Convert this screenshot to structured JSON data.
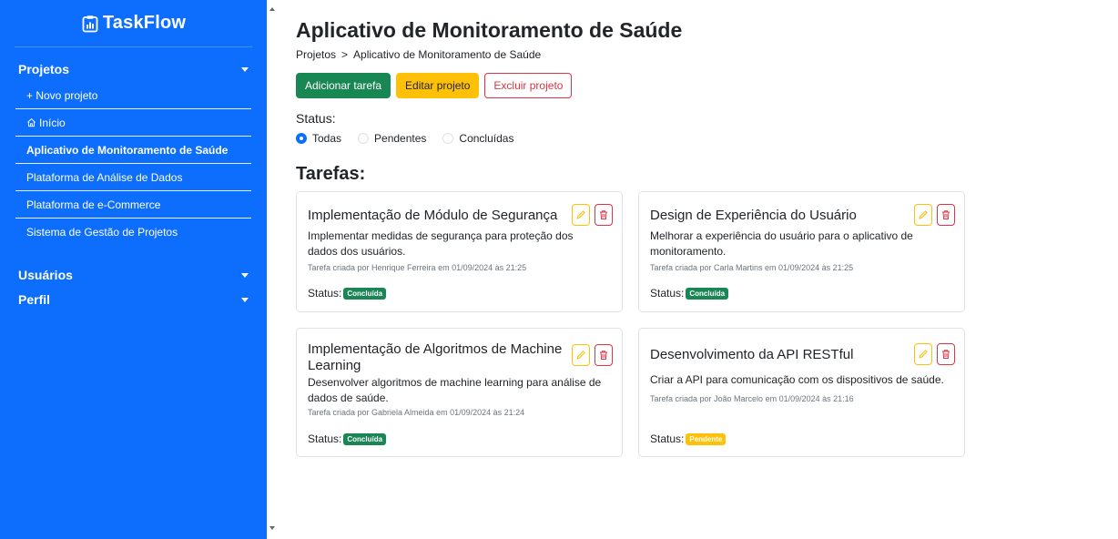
{
  "app": {
    "brand": "TaskFlow"
  },
  "sidebar": {
    "projects_heading": "Projetos",
    "items": [
      {
        "label": "+ Novo projeto"
      },
      {
        "label": "Início"
      },
      {
        "label": "Aplicativo de Monitoramento de Saúde"
      },
      {
        "label": "Plataforma de Análise de Dados"
      },
      {
        "label": "Plataforma de e-Commerce"
      },
      {
        "label": "Sistema de Gestão de Projetos"
      }
    ],
    "users_heading": "Usuários",
    "profile_heading": "Perfil"
  },
  "page": {
    "title": "Aplicativo de Monitoramento de Saúde",
    "breadcrumb": {
      "root": "Projetos",
      "separator": ">",
      "current": "Aplicativo de Monitoramento de Saúde"
    }
  },
  "actions": {
    "add": "Adicionar tarefa",
    "edit": "Editar projeto",
    "delete": "Excluir projeto"
  },
  "filter": {
    "label": "Status:",
    "options": [
      {
        "label": "Todas",
        "selected": true
      },
      {
        "label": "Pendentes",
        "selected": false
      },
      {
        "label": "Concluídas",
        "selected": false
      }
    ]
  },
  "tasks_heading": "Tarefas:",
  "tasks": [
    {
      "title": "Implementação de Módulo de Segurança",
      "description": "Implementar medidas de segurança para proteção dos dados dos usuários.",
      "meta": "Tarefa criada por Henrique Ferreira em 01/09/2024 às 21:25",
      "status_label": "Status:",
      "status": "Concluída"
    },
    {
      "title": "Design de Experiência do Usuário",
      "description": "Melhorar a experiência do usuário para o aplicativo de monitoramento.",
      "meta": "Tarefa criada por Carla Martins em 01/09/2024 às 21:25",
      "status_label": "Status:",
      "status": "Concluída"
    },
    {
      "title": "Implementação de Algoritmos de Machine Learning",
      "description": "Desenvolver algoritmos de machine learning para análise de dados de saúde.",
      "meta": "Tarefa criada por Gabriela Almeida em 01/09/2024 às 21:24",
      "status_label": "Status:",
      "status": "Concluída"
    },
    {
      "title": "Desenvolvimento da API RESTful",
      "description": "Criar a API para comunicação com os dispositivos de saúde.",
      "meta": "Tarefa criada por João Marcelo em 01/09/2024 às 21:16",
      "status_label": "Status:",
      "status": "Pendente"
    }
  ],
  "colors": {
    "primary": "#0d6efd",
    "success": "#198754",
    "warning": "#ffc107",
    "danger": "#dc3545"
  }
}
